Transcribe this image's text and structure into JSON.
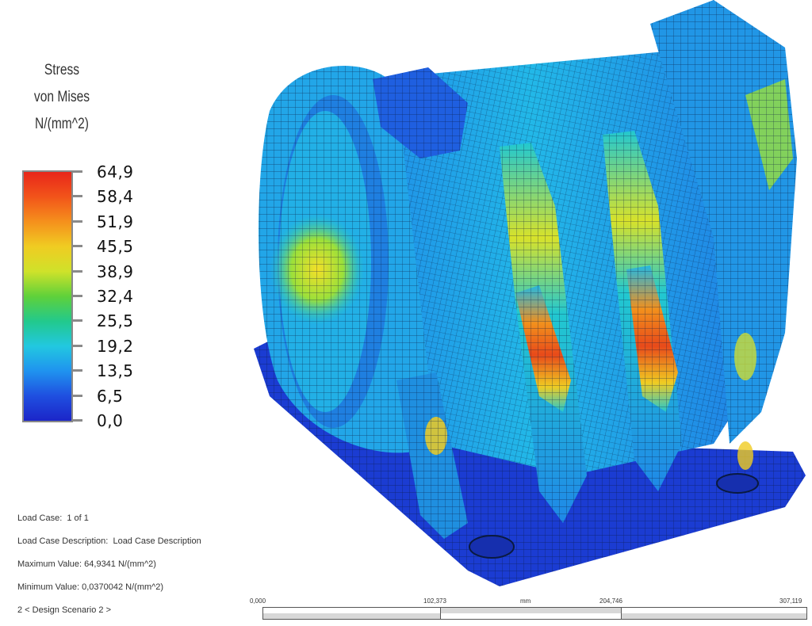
{
  "legend": {
    "title_line1": "Stress",
    "title_line2": "von Mises",
    "title_line3": "N/(mm^2)",
    "values": [
      "64,9",
      "58,4",
      "51,9",
      "45,5",
      "38,9",
      "32,4",
      "25,5",
      "19,2",
      "13,5",
      "6,5",
      "0,0"
    ],
    "colors": [
      "#e8261a",
      "#f2541a",
      "#f5901c",
      "#f0cc22",
      "#cfe22a",
      "#5fd13a",
      "#22c98c",
      "#22c8e0",
      "#1f93ef",
      "#1f4fe0",
      "#1b25c8"
    ]
  },
  "info": {
    "load_case": "Load Case:  1 of 1",
    "load_case_description": "Load Case Description:  Load Case Description",
    "maximum_value": "Maximum Value: 64,9341 N/(mm^2)",
    "minimum_value": "Minimum Value: 0,0370042 N/(mm^2)",
    "design_scenario": "2 < Design Scenario 2 >"
  },
  "scale": {
    "label_0": "0,000",
    "label_1": "102,373",
    "unit": "mm",
    "label_2": "204,746",
    "label_3": "307,119"
  }
}
